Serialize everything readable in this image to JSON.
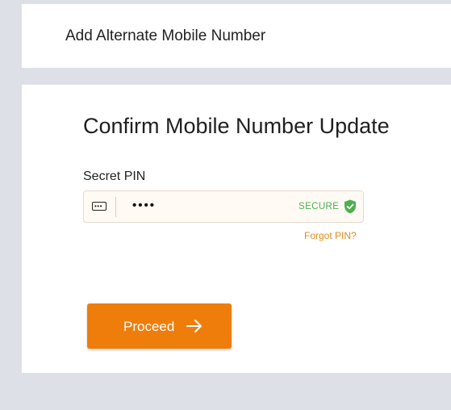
{
  "header": {
    "title": "Add Alternate Mobile Number"
  },
  "main": {
    "heading": "Confirm Mobile Number Update",
    "pin": {
      "label": "Secret PIN",
      "value": "••••",
      "secure_label": "SECURE",
      "icon": "keyboard-icon",
      "secure_icon": "shield-check-icon",
      "secure_color": "#4caf50"
    },
    "forgot_pin": "Forgot PIN?",
    "proceed": {
      "label": "Proceed",
      "icon": "arrow-right-icon",
      "color": "#ef7d0b"
    }
  },
  "colors": {
    "background": "#dde1e7",
    "card": "#ffffff",
    "link": "#e08a1e"
  }
}
